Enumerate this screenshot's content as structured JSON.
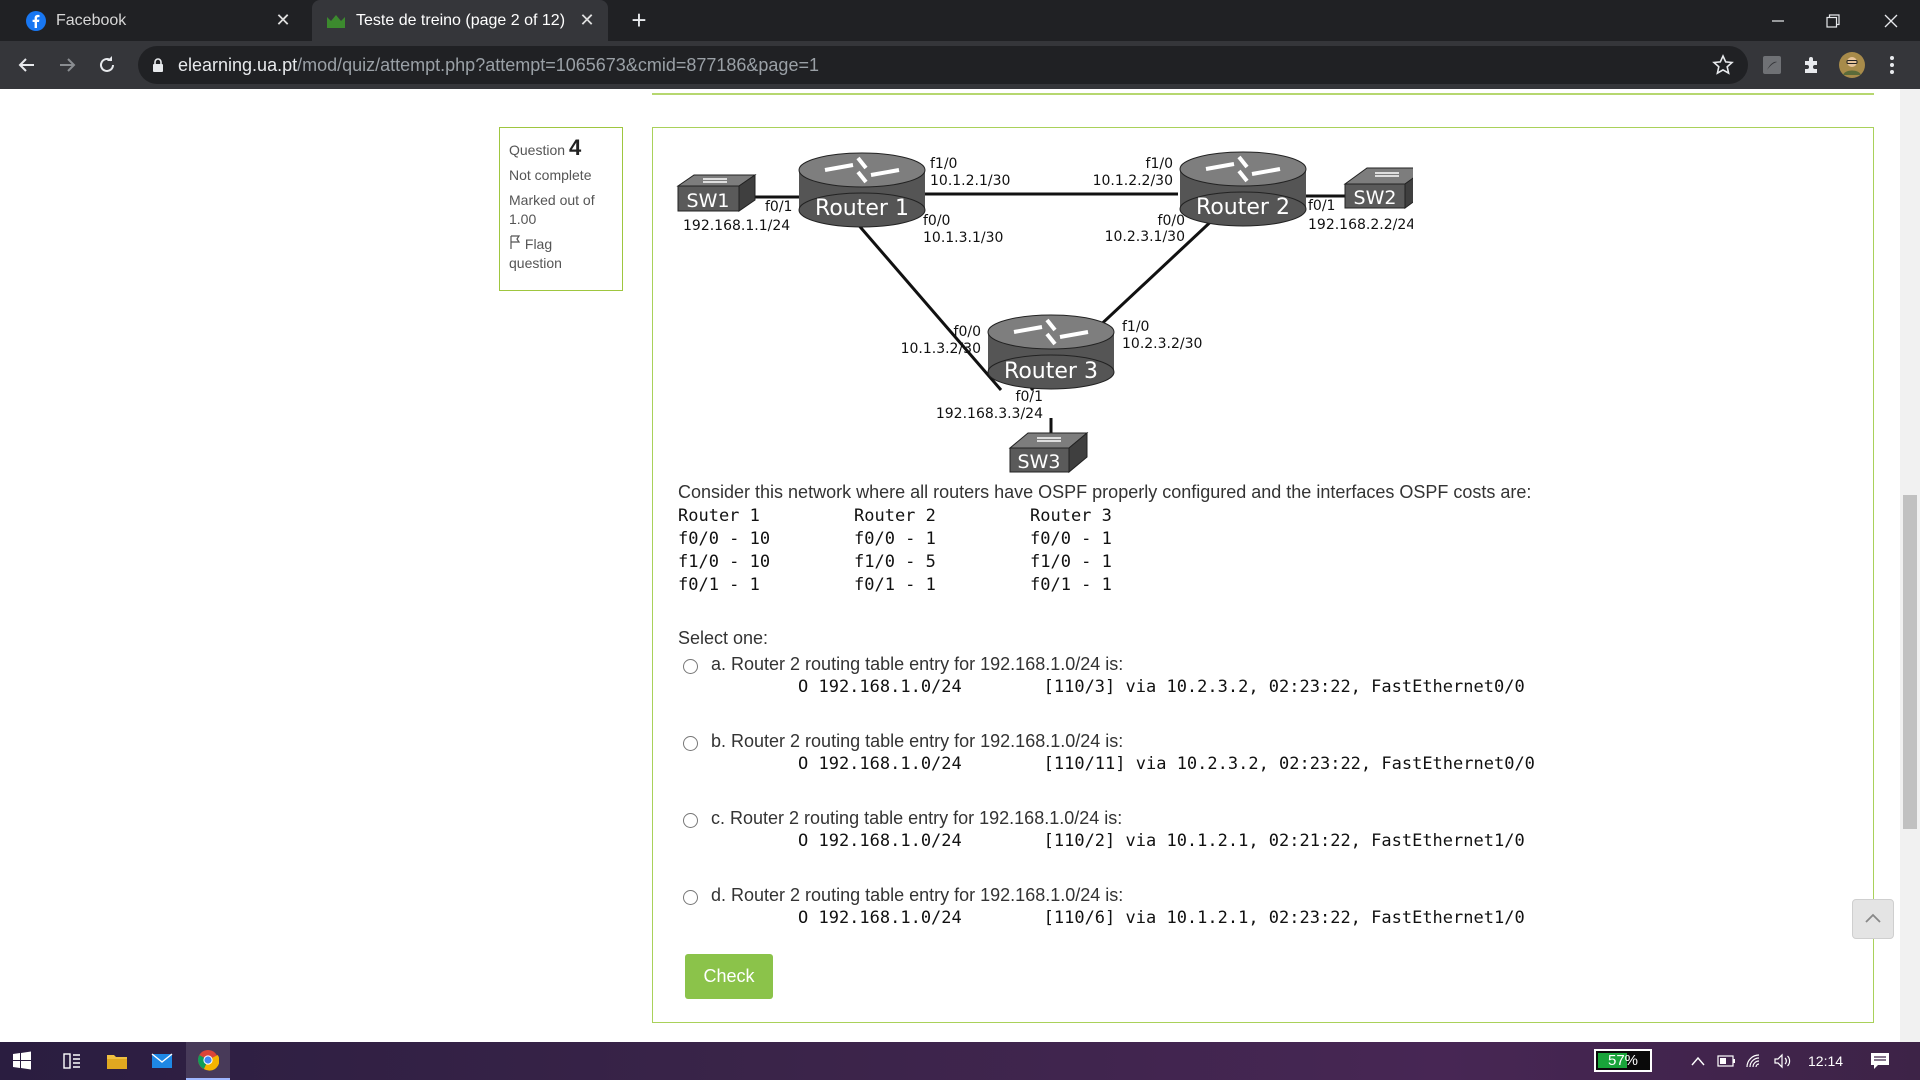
{
  "browser": {
    "tabs": [
      {
        "title": "Facebook",
        "icon": "facebook-icon"
      },
      {
        "title": "Teste de treino (page 2 of 12)",
        "icon": "moodle-icon",
        "active": true
      }
    ],
    "url_host": "elearning.ua.pt",
    "url_path": "/mod/quiz/attempt.php?attempt=1065673&cmid=877186&page=1"
  },
  "question_info": {
    "label": "Question",
    "number": "4",
    "status": "Not complete",
    "marked_line1": "Marked out of",
    "marked_line2": "1.00",
    "flag_line1": "Flag",
    "flag_line2": "question"
  },
  "diagram": {
    "sw1": "SW1",
    "sw2": "SW2",
    "sw3": "SW3",
    "router1": "Router 1",
    "router2": "Router 2",
    "router3": "Router 3",
    "sw1_ip": "192.168.1.1/24",
    "r1_f01": "f0/1",
    "r1_f10": "f1/0",
    "r1_f10_ip": "10.1.2.1/30",
    "r1_f00": "f0/0",
    "r1_f00_ip": "10.1.3.1/30",
    "r2_f10": "f1/0",
    "r2_f10_ip": "10.1.2.2/30",
    "r2_f00": "f0/0",
    "r2_f00_ip": "10.2.3.1/30",
    "r2_f01": "f0/1",
    "sw2_ip": "192.168.2.2/24",
    "r3_f00": "f0/0",
    "r3_f00_ip": "10.1.3.2/30",
    "r3_f10": "f1/0",
    "r3_f10_ip": "10.2.3.2/30",
    "r3_f01": "f0/1",
    "sw3_ip": "192.168.3.3/24"
  },
  "question": {
    "text": "Consider this network where all routers have OSPF properly configured and the interfaces OSPF costs are:",
    "costs": [
      {
        "router": "Router 1",
        "f00": "f0/0 - 10",
        "f10": "f1/0 - 10",
        "f01": "f0/1 - 1"
      },
      {
        "router": "Router 2",
        "f00": "f0/0 - 1",
        "f10": "f1/0 - 5",
        "f01": "f0/1 - 1"
      },
      {
        "router": "Router 3",
        "f00": "f0/0 - 1",
        "f10": "f1/0 - 1",
        "f01": "f0/1 - 1"
      }
    ],
    "select_one": "Select one:",
    "options": [
      {
        "text": "a. Router 2 routing table entry for 192.168.1.0/24 is:",
        "code": "O 192.168.1.0/24        [110/3] via 10.2.3.2, 02:23:22, FastEthernet0/0"
      },
      {
        "text": "b. Router 2 routing table entry for 192.168.1.0/24 is:",
        "code": "O 192.168.1.0/24        [110/11] via 10.2.3.2, 02:23:22, FastEthernet0/0"
      },
      {
        "text": "c. Router 2 routing table entry for 192.168.1.0/24 is:",
        "code": "O 192.168.1.0/24        [110/2] via 10.1.2.1, 02:21:22, FastEthernet1/0"
      },
      {
        "text": "d. Router 2 routing table entry for 192.168.1.0/24 is:",
        "code": "O 192.168.1.0/24        [110/6] via 10.1.2.1, 02:23:22, FastEthernet1/0"
      }
    ],
    "check_label": "Check"
  },
  "taskbar": {
    "battery_label": "57%",
    "battery_level": 0.57,
    "time": "12:14"
  },
  "colors": {
    "accent_green": "#8bc34a",
    "border_green": "#a9d15a",
    "chrome_dark": "#202124",
    "chrome_toolbar": "#35363a"
  }
}
